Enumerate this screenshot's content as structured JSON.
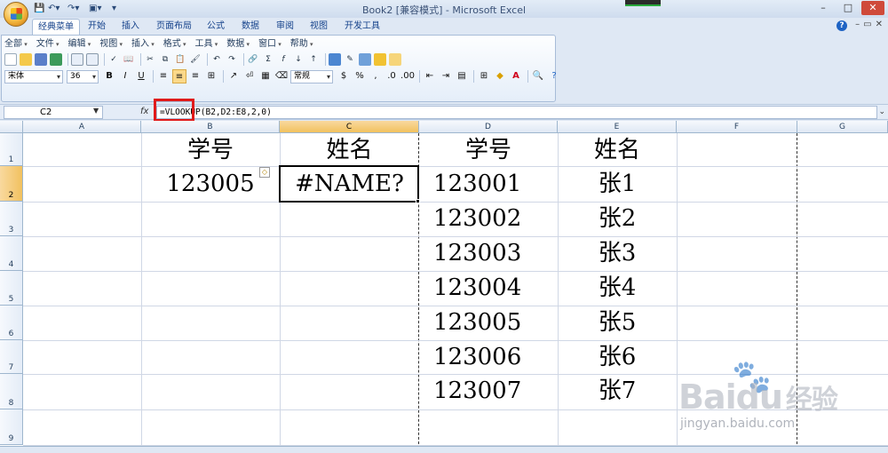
{
  "window": {
    "title": "Book2  [兼容模式] - Microsoft Excel",
    "controls": [
      "–",
      "□",
      "✕"
    ]
  },
  "ribbon_tabs": [
    "经典菜单",
    "开始",
    "插入",
    "页面布局",
    "公式",
    "数据",
    "审阅",
    "视图",
    "开发工具"
  ],
  "active_tab": "经典菜单",
  "classic_menu": [
    "全部",
    "文件",
    "编辑",
    "视图",
    "插入",
    "格式",
    "工具",
    "数据",
    "窗口",
    "帮助"
  ],
  "format_bar": {
    "font": "宋体",
    "size": "36",
    "bold": "B",
    "italic": "I",
    "underline": "U",
    "number_format": "常规",
    "percent": "%",
    "comma": ","
  },
  "formula_bar": {
    "cell_ref": "C2",
    "fx": "fx",
    "formula": "=VLOOKUP(B2,D2:E8,2,0)"
  },
  "columns": [
    "A",
    "B",
    "C",
    "D",
    "E",
    "F",
    "G"
  ],
  "selected_column": "C",
  "rows": [
    "1",
    "2",
    "3",
    "4",
    "5",
    "6",
    "7",
    "8",
    "9"
  ],
  "selected_row": "2",
  "cells": {
    "B1": "学号",
    "C1": "姓名",
    "D1": "学号",
    "E1": "姓名",
    "B2": "123005",
    "C2": "#NAME?",
    "lookup_table": [
      {
        "id": "123001",
        "name": "张1"
      },
      {
        "id": "123002",
        "name": "张2"
      },
      {
        "id": "123003",
        "name": "张3"
      },
      {
        "id": "123004",
        "name": "张4"
      },
      {
        "id": "123005",
        "name": "张5"
      },
      {
        "id": "123006",
        "name": "张6"
      },
      {
        "id": "123007",
        "name": "张7"
      }
    ]
  },
  "watermark": {
    "brand": "Bai",
    "brand2": "du",
    "brand3": "经验",
    "url": "jingyan.baidu.com"
  },
  "colors": {
    "highlight_box": "#e01a1a",
    "selected_header": "#f1c15f"
  }
}
